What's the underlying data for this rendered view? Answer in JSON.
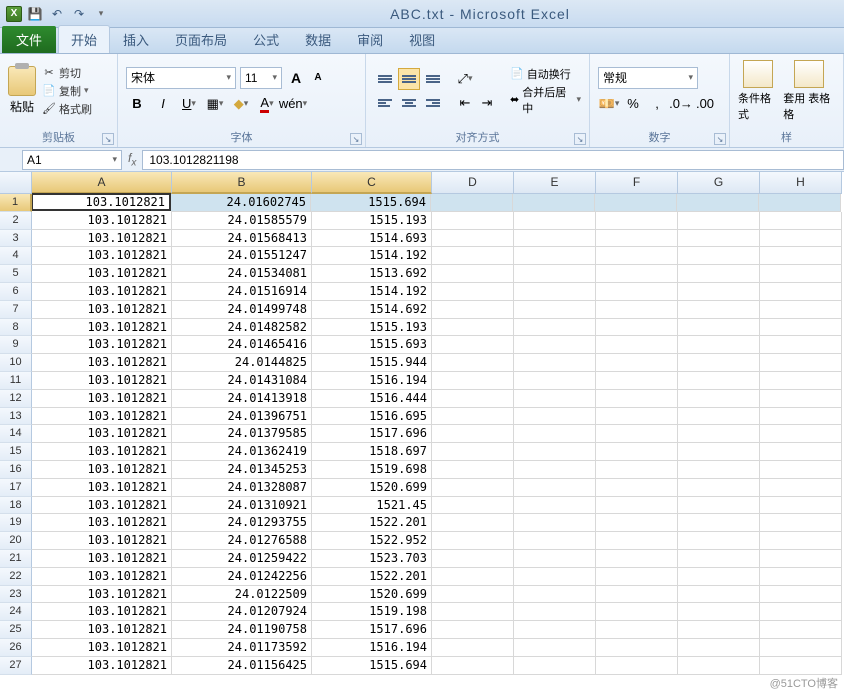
{
  "title": "ABC.txt - Microsoft Excel",
  "qat": {
    "save": "💾",
    "undo": "↶",
    "redo": "↷"
  },
  "tabs": {
    "file": "文件",
    "items": [
      "开始",
      "插入",
      "页面布局",
      "公式",
      "数据",
      "审阅",
      "视图"
    ],
    "active": 0
  },
  "ribbon": {
    "clipboard": {
      "paste": "粘贴",
      "cut": "剪切",
      "copy": "复制",
      "format_painter": "格式刷",
      "label": "剪贴板"
    },
    "font": {
      "name": "宋体",
      "size": "11",
      "label": "字体"
    },
    "align": {
      "wrap": "自动换行",
      "merge": "合并后居中",
      "label": "对齐方式"
    },
    "number": {
      "format": "常规",
      "label": "数字"
    },
    "styles": {
      "cond": "条件格式",
      "table": "套用\n表格格",
      "label": "样"
    }
  },
  "namebox": "A1",
  "formula": "103.1012821198",
  "cols": [
    "A",
    "B",
    "C",
    "D",
    "E",
    "F",
    "G",
    "H"
  ],
  "rows": [
    {
      "a": "103.1012821",
      "b": "24.01602745",
      "c": "1515.694"
    },
    {
      "a": "103.1012821",
      "b": "24.01585579",
      "c": "1515.193"
    },
    {
      "a": "103.1012821",
      "b": "24.01568413",
      "c": "1514.693"
    },
    {
      "a": "103.1012821",
      "b": "24.01551247",
      "c": "1514.192"
    },
    {
      "a": "103.1012821",
      "b": "24.01534081",
      "c": "1513.692"
    },
    {
      "a": "103.1012821",
      "b": "24.01516914",
      "c": "1514.192"
    },
    {
      "a": "103.1012821",
      "b": "24.01499748",
      "c": "1514.692"
    },
    {
      "a": "103.1012821",
      "b": "24.01482582",
      "c": "1515.193"
    },
    {
      "a": "103.1012821",
      "b": "24.01465416",
      "c": "1515.693"
    },
    {
      "a": "103.1012821",
      "b": "24.0144825",
      "c": "1515.944"
    },
    {
      "a": "103.1012821",
      "b": "24.01431084",
      "c": "1516.194"
    },
    {
      "a": "103.1012821",
      "b": "24.01413918",
      "c": "1516.444"
    },
    {
      "a": "103.1012821",
      "b": "24.01396751",
      "c": "1516.695"
    },
    {
      "a": "103.1012821",
      "b": "24.01379585",
      "c": "1517.696"
    },
    {
      "a": "103.1012821",
      "b": "24.01362419",
      "c": "1518.697"
    },
    {
      "a": "103.1012821",
      "b": "24.01345253",
      "c": "1519.698"
    },
    {
      "a": "103.1012821",
      "b": "24.01328087",
      "c": "1520.699"
    },
    {
      "a": "103.1012821",
      "b": "24.01310921",
      "c": "1521.45"
    },
    {
      "a": "103.1012821",
      "b": "24.01293755",
      "c": "1522.201"
    },
    {
      "a": "103.1012821",
      "b": "24.01276588",
      "c": "1522.952"
    },
    {
      "a": "103.1012821",
      "b": "24.01259422",
      "c": "1523.703"
    },
    {
      "a": "103.1012821",
      "b": "24.01242256",
      "c": "1522.201"
    },
    {
      "a": "103.1012821",
      "b": "24.0122509",
      "c": "1520.699"
    },
    {
      "a": "103.1012821",
      "b": "24.01207924",
      "c": "1519.198"
    },
    {
      "a": "103.1012821",
      "b": "24.01190758",
      "c": "1517.696"
    },
    {
      "a": "103.1012821",
      "b": "24.01173592",
      "c": "1516.194"
    },
    {
      "a": "103.1012821",
      "b": "24.01156425",
      "c": "1515.694"
    }
  ],
  "watermark": "@51CTO博客"
}
